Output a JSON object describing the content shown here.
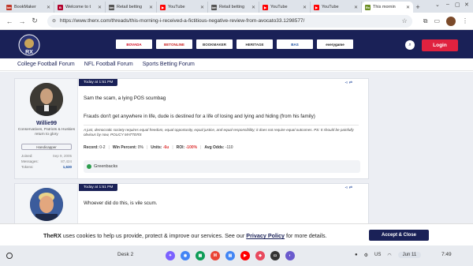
{
  "browser": {
    "tabs": [
      {
        "label": "BookMaker",
        "favicon_color": "#c0392b",
        "favicon_text": "bm"
      },
      {
        "label": "Welcome to t",
        "favicon_color": "#b2002b",
        "favicon_text": "B"
      },
      {
        "label": "Retail betting",
        "favicon_color": "#555555",
        "favicon_text": "bm"
      },
      {
        "label": "YouTube",
        "favicon_color": "#ff0000",
        "favicon_text": "▶"
      },
      {
        "label": "Retail betting",
        "favicon_color": "#555555",
        "favicon_text": "bm"
      },
      {
        "label": "YouTube",
        "favicon_color": "#ff0000",
        "favicon_text": "▶"
      },
      {
        "label": "YouTube",
        "favicon_color": "#ff0000",
        "favicon_text": "▶"
      },
      {
        "label": "This mornin",
        "favicon_color": "#6b8e23",
        "favicon_text": "Rx",
        "active": true
      }
    ],
    "url": "https://www.therx.com/threads/this-morning-i-received-a-fictitious-negative-review-from-avocato33.1298577/"
  },
  "header": {
    "logo_text": "THE RX",
    "sponsors": [
      "BOVADA",
      "BETONLINE",
      "BOOKMAKER",
      "HERITAGE",
      "BAS",
      "everygame"
    ],
    "login_label": "Login"
  },
  "subnav": [
    "College Football Forum",
    "NFL Football Forum",
    "Sports Betting Forum"
  ],
  "posts": [
    {
      "username": "Willie99",
      "user_title": "Conservatives, Patriots & Huskies return to glory",
      "role": "Handicapper",
      "stats": [
        {
          "label": "Joined:",
          "value": "Sep 9, 2005"
        },
        {
          "label": "Messages:",
          "value": "87,424"
        },
        {
          "label": "Tokens:",
          "value": "1,630"
        }
      ],
      "date": "Today at 1:51 PM",
      "lines": [
        "Sam the scam, a lying POS scumbag",
        "Frauds don't get anywhere in life, dude is destined for a life of losing and lying and hiding (from his family)"
      ],
      "signature": "A just, democratic society requires equal freedom, equal opportunity, equal justice, and equal responsibility; it does not require equal outcomes. PS: It should be painfully obvious by now, POLICY MATTERS",
      "record": {
        "record_label": "Record:",
        "record_value": "0-2",
        "win_label": "Win Percent:",
        "win_value": "0%",
        "units_label": "Units:",
        "units_value": "-6u",
        "roi_label": "ROI:",
        "roi_value": "-100%",
        "odds_label": "Avg Odds:",
        "odds_value": "-110"
      },
      "reaction": "Greenbacks"
    },
    {
      "date": "Today at 1:51 PM",
      "lines": [
        "Whoever did do this, is vile scum."
      ]
    }
  ],
  "cookie": {
    "brand": "TheRX",
    "text_before": " uses cookies to help us provide, protect & improve our services. See our ",
    "link": "Privacy Policy",
    "text_after": " for more details.",
    "accept_label": "Accept & Close"
  },
  "shelf": {
    "desk_label": "Desk 2",
    "region": "US",
    "date": "Jun 11",
    "time": "7:49"
  }
}
